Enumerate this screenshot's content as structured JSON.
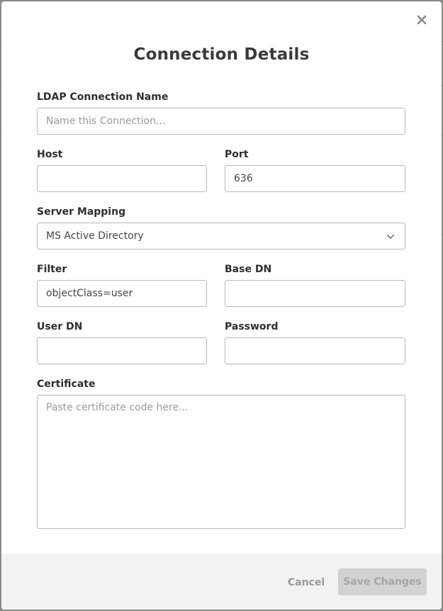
{
  "dialog": {
    "title": "Connection Details",
    "close_icon": "close-icon"
  },
  "form": {
    "connection_name": {
      "label": "LDAP Connection Name",
      "value": "",
      "placeholder": "Name this Connection..."
    },
    "host": {
      "label": "Host",
      "value": "",
      "placeholder": ""
    },
    "port": {
      "label": "Port",
      "value": "636",
      "placeholder": ""
    },
    "server_mapping": {
      "label": "Server Mapping",
      "value": "MS Active Directory",
      "icon": "chevron-down-icon"
    },
    "filter": {
      "label": "Filter",
      "value": "objectClass=user",
      "placeholder": ""
    },
    "base_dn": {
      "label": "Base DN",
      "value": "",
      "placeholder": ""
    },
    "user_dn": {
      "label": "User DN",
      "value": "",
      "placeholder": ""
    },
    "password": {
      "label": "Password",
      "value": "",
      "placeholder": ""
    },
    "certificate": {
      "label": "Certificate",
      "value": "",
      "placeholder": "Paste certificate code here..."
    }
  },
  "footer": {
    "cancel_label": "Cancel",
    "save_label": "Save Changes"
  },
  "colors": {
    "title": "#3a3a3a",
    "cancel_text": "#9a9a9a",
    "save_bg_disabled": "#d2d2d2",
    "save_text_disabled": "#a6a6a6",
    "footer_bg": "#f2f2f2",
    "input_border": "#b8b8b8"
  }
}
